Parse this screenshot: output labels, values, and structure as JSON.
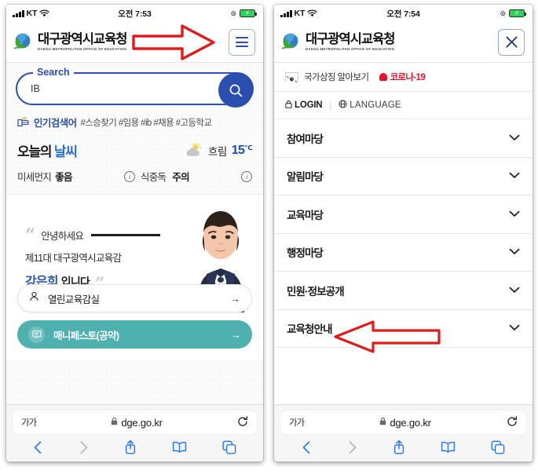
{
  "left": {
    "status": {
      "carrier": "KT",
      "time": "오전 7:53",
      "signal_icon": "signal-bars-icon",
      "wifi_icon": "wifi-icon",
      "lock_icon": "orientation-lock-icon",
      "battery_icon": "battery-charging-icon"
    },
    "header": {
      "logo_icon": "globe-logo-icon",
      "title_ko": "대구광역시교육청",
      "title_en": "DAEGU METROPOLITAN OFFICE OF EDUCATION",
      "menu_button": "hamburger-menu-icon"
    },
    "search": {
      "label": "Search",
      "value": "IB",
      "placeholder": "",
      "button_icon": "magnifier-icon"
    },
    "popular": {
      "icon": "popular-keyword-icon",
      "title": "인기검색어",
      "tags": "#스승찾기 #임용 #ib #채용 #고등학교"
    },
    "weather": {
      "title_prefix": "오늘의 ",
      "title_accent": "날씨",
      "icon": "sun-cloud-icon",
      "condition": "흐림",
      "temp": "15",
      "temp_unit": "℃",
      "dust_label": "미세먼지",
      "dust_value": "좋음",
      "food_label": "식중독",
      "food_value": "주의",
      "info_icon": "info-circle-icon"
    },
    "greeting": {
      "open_quote": "“",
      "close_quote": "”",
      "line1": "안녕하세요",
      "line2": "제11대 대구광역시교육감",
      "name": "강은희",
      "name_suffix": "입니다.",
      "portrait_icon": "superintendent-portrait"
    },
    "links": [
      {
        "label": "열린교육감실",
        "icon": "person-icon",
        "arrow": "→",
        "style": "white"
      },
      {
        "label": "매니페스토(공약)",
        "icon": "document-icon",
        "arrow": "→",
        "style": "teal"
      }
    ],
    "browser": {
      "aa_label": "가가",
      "lock_icon": "padlock-icon",
      "url": "dge.go.kr",
      "reload_icon": "reload-icon",
      "back_icon": "back-chevron-icon",
      "forward_icon": "forward-chevron-icon",
      "share_icon": "share-icon",
      "bookmarks_icon": "book-icon",
      "tabs_icon": "tabs-icon"
    }
  },
  "right": {
    "status": {
      "carrier": "KT",
      "time": "오전 7:54",
      "signal_icon": "signal-bars-icon",
      "wifi_icon": "wifi-icon",
      "lock_icon": "orientation-lock-icon",
      "battery_icon": "battery-charging-icon"
    },
    "header": {
      "logo_icon": "globe-logo-icon",
      "title_ko": "대구광역시교육청",
      "title_en": "DAEGU METROPOLITAN OFFICE OF EDUCATION",
      "close_button": "close-x-icon"
    },
    "notice": {
      "flag_icon": "korea-flag-icon",
      "text": "국가상징 알아보기",
      "siren_icon": "siren-icon",
      "corona": "코로나-19"
    },
    "utility": {
      "login_icon": "padlock-icon",
      "login": "LOGIN",
      "separator": "|",
      "lang_icon": "globe-icon",
      "language": "LANGUAGE"
    },
    "menu": [
      {
        "label": "참여마당",
        "chevron": "chevron-down-icon"
      },
      {
        "label": "알림마당",
        "chevron": "chevron-down-icon"
      },
      {
        "label": "교육마당",
        "chevron": "chevron-down-icon"
      },
      {
        "label": "행정마당",
        "chevron": "chevron-down-icon"
      },
      {
        "label": "민원·정보공개",
        "chevron": "chevron-down-icon"
      },
      {
        "label": "교육청안내",
        "chevron": "chevron-down-icon"
      }
    ],
    "browser": {
      "aa_label": "가가",
      "lock_icon": "padlock-icon",
      "url": "dge.go.kr",
      "reload_icon": "reload-icon",
      "back_icon": "back-chevron-icon",
      "forward_icon": "forward-chevron-icon",
      "share_icon": "share-icon",
      "bookmarks_icon": "book-icon",
      "tabs_icon": "tabs-icon"
    }
  },
  "annotations": {
    "arrow_color": "#e01b1b",
    "left_arrow_target": "hamburger-menu-icon",
    "right_arrow_target": "교육청안내"
  }
}
